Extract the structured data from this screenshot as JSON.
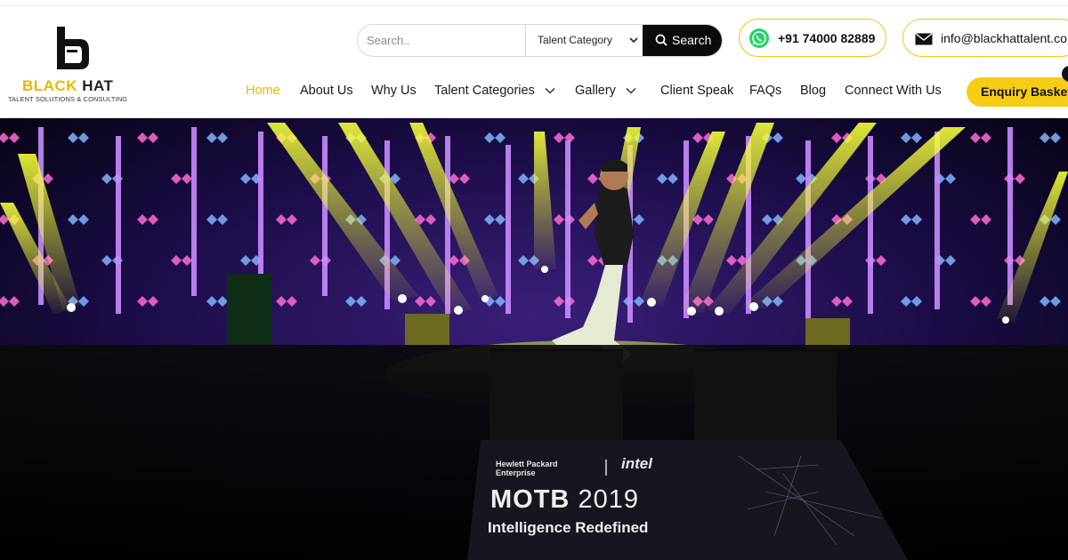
{
  "brand": {
    "name_part1": "BLACK",
    "name_part2": "HAT",
    "tagline": "TALENT SOLUTIONS & CONSULTING",
    "logo_icon": "black-hat-b-logo",
    "accent_color": "#f7cc16"
  },
  "search": {
    "placeholder": "Search..",
    "category_selected": "Talent Category",
    "button_label": "Search"
  },
  "contact": {
    "phone": "+91 74000 82889",
    "email": "info@blackhattalent.co"
  },
  "nav": {
    "items": [
      {
        "label": "Home",
        "active": true
      },
      {
        "label": "About Us"
      },
      {
        "label": "Why Us"
      },
      {
        "label": "Talent Categories",
        "dropdown": true
      },
      {
        "label": "Gallery",
        "dropdown": true
      },
      {
        "label": "Client Speak"
      },
      {
        "label": "FAQs"
      },
      {
        "label": "Blog"
      },
      {
        "label": "Connect With Us"
      }
    ],
    "enquiry_label": "Enquiry Basket"
  },
  "hero": {
    "sponsor_line1": "Hewlett Packard",
    "sponsor_line2": "Enterprise",
    "partner": "intel",
    "event_name": "MOTB",
    "event_year": "2019",
    "event_tagline": "Intelligence Redefined"
  },
  "icons": {
    "whatsapp": "whatsapp-icon",
    "mail": "mail-icon",
    "search": "search-icon",
    "chevron": "chevron-down-icon"
  }
}
